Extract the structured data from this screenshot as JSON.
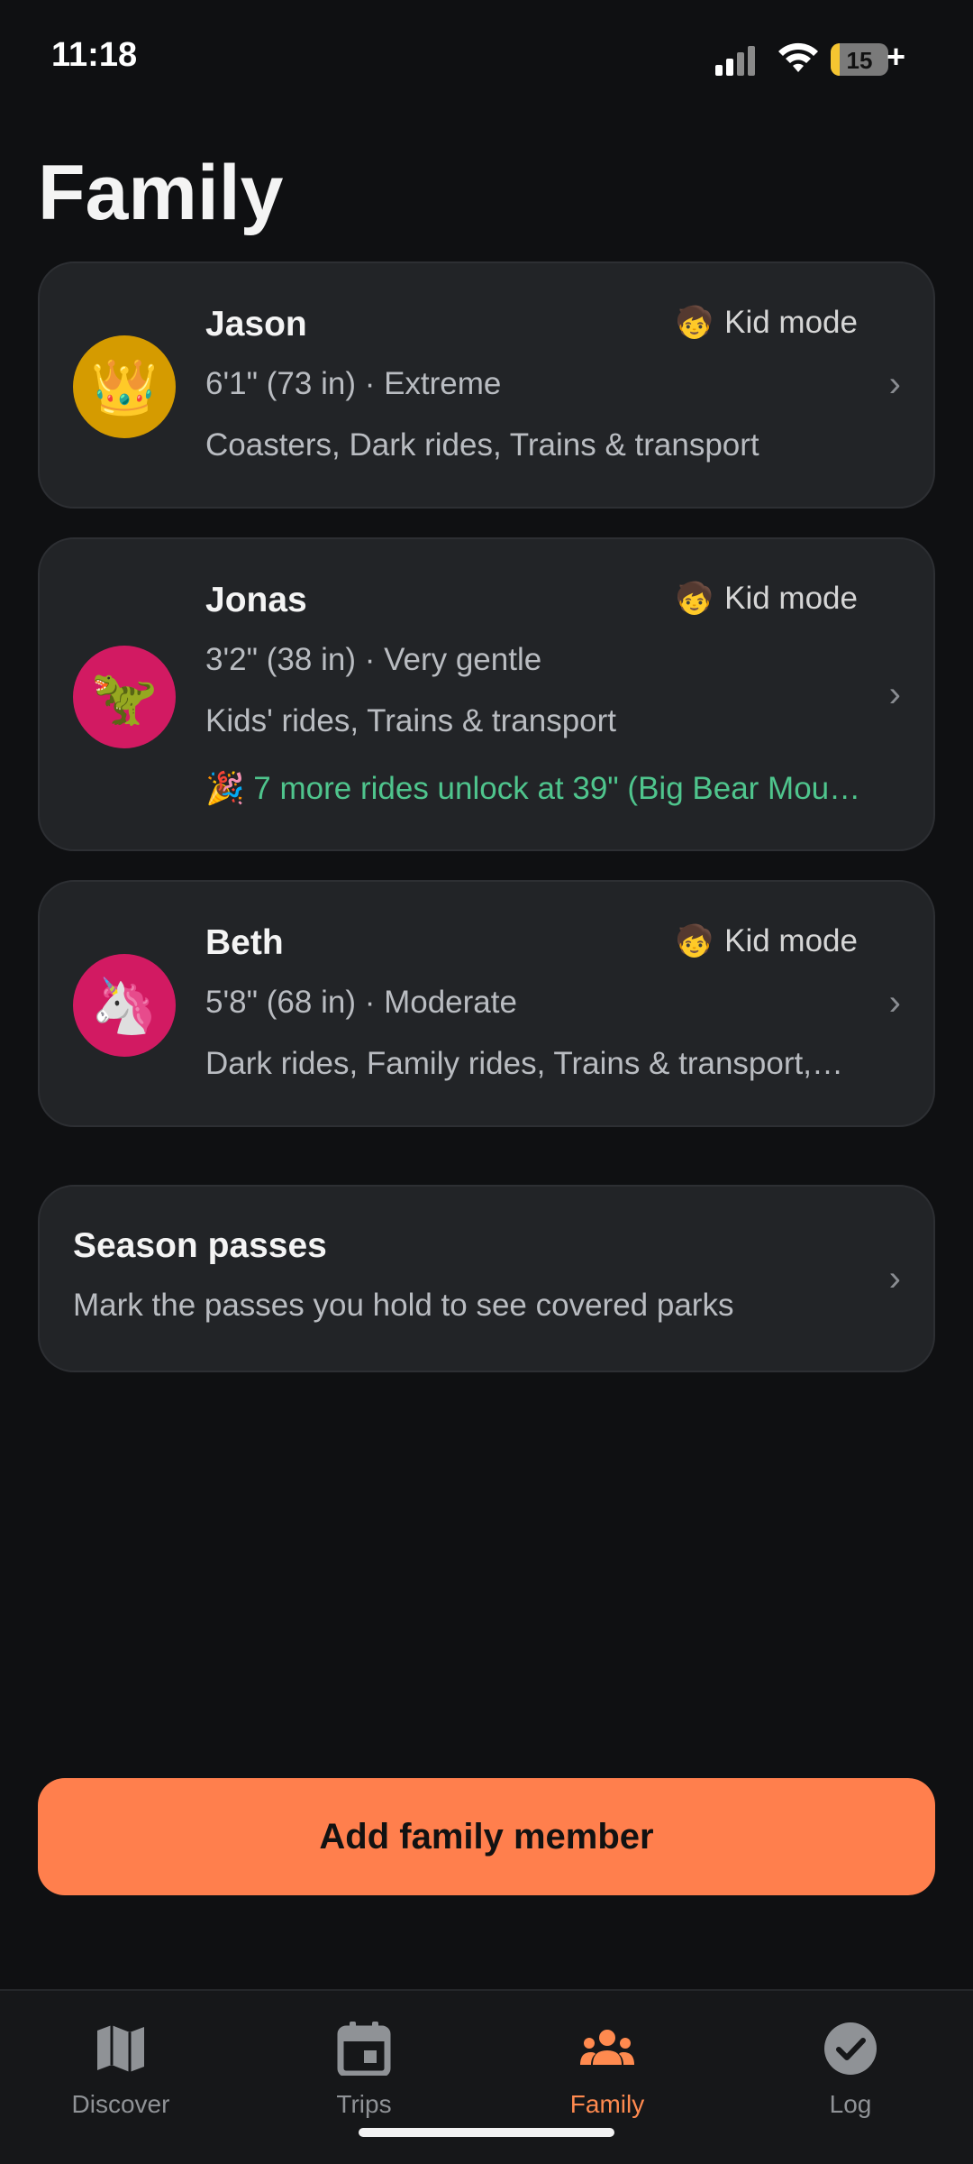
{
  "status_bar": {
    "time": "11:18",
    "battery": "15",
    "battery_level": 0.15,
    "battery_plus": "+"
  },
  "page": {
    "title": "Family"
  },
  "members": [
    {
      "name": "Jason",
      "avatar_emoji": "👑",
      "avatar_color": "#d59b00",
      "kid_mode_emoji": "🧒",
      "kid_mode_label": "Kid mode",
      "height_intensity": "6'1\" (73 in) · Extreme",
      "interests": "Coasters, Dark rides, Trains & transport"
    },
    {
      "name": "Jonas",
      "avatar_emoji": "🦖",
      "avatar_color": "#d21a62",
      "kid_mode_emoji": "🧒",
      "kid_mode_label": "Kid mode",
      "height_intensity": "3'2\" (38 in) · Very gentle",
      "interests": "Kids' rides, Trains & transport",
      "unlock_note": "🎉 7 more rides unlock at 39\" (Big Bear Mou…"
    },
    {
      "name": "Beth",
      "avatar_emoji": "🦄",
      "avatar_color": "#d21a62",
      "kid_mode_emoji": "🧒",
      "kid_mode_label": "Kid mode",
      "height_intensity": "5'8\" (68 in) · Moderate",
      "interests": "Dark rides, Family rides, Trains & transport,…"
    }
  ],
  "season_passes": {
    "title": "Season passes",
    "subtitle": "Mark the passes you hold to see covered parks"
  },
  "add_button": {
    "label": "Add family member"
  },
  "tabs": [
    {
      "label": "Discover",
      "icon": "map-icon",
      "active": false
    },
    {
      "label": "Trips",
      "icon": "calendar-icon",
      "active": false
    },
    {
      "label": "Family",
      "icon": "group-icon",
      "active": true
    },
    {
      "label": "Log",
      "icon": "check-circle-icon",
      "active": false
    }
  ],
  "colors": {
    "accent": "#ff7f4d",
    "background": "#0f1012",
    "card": "#222427",
    "success": "#4fc58d"
  },
  "chevron": "›"
}
